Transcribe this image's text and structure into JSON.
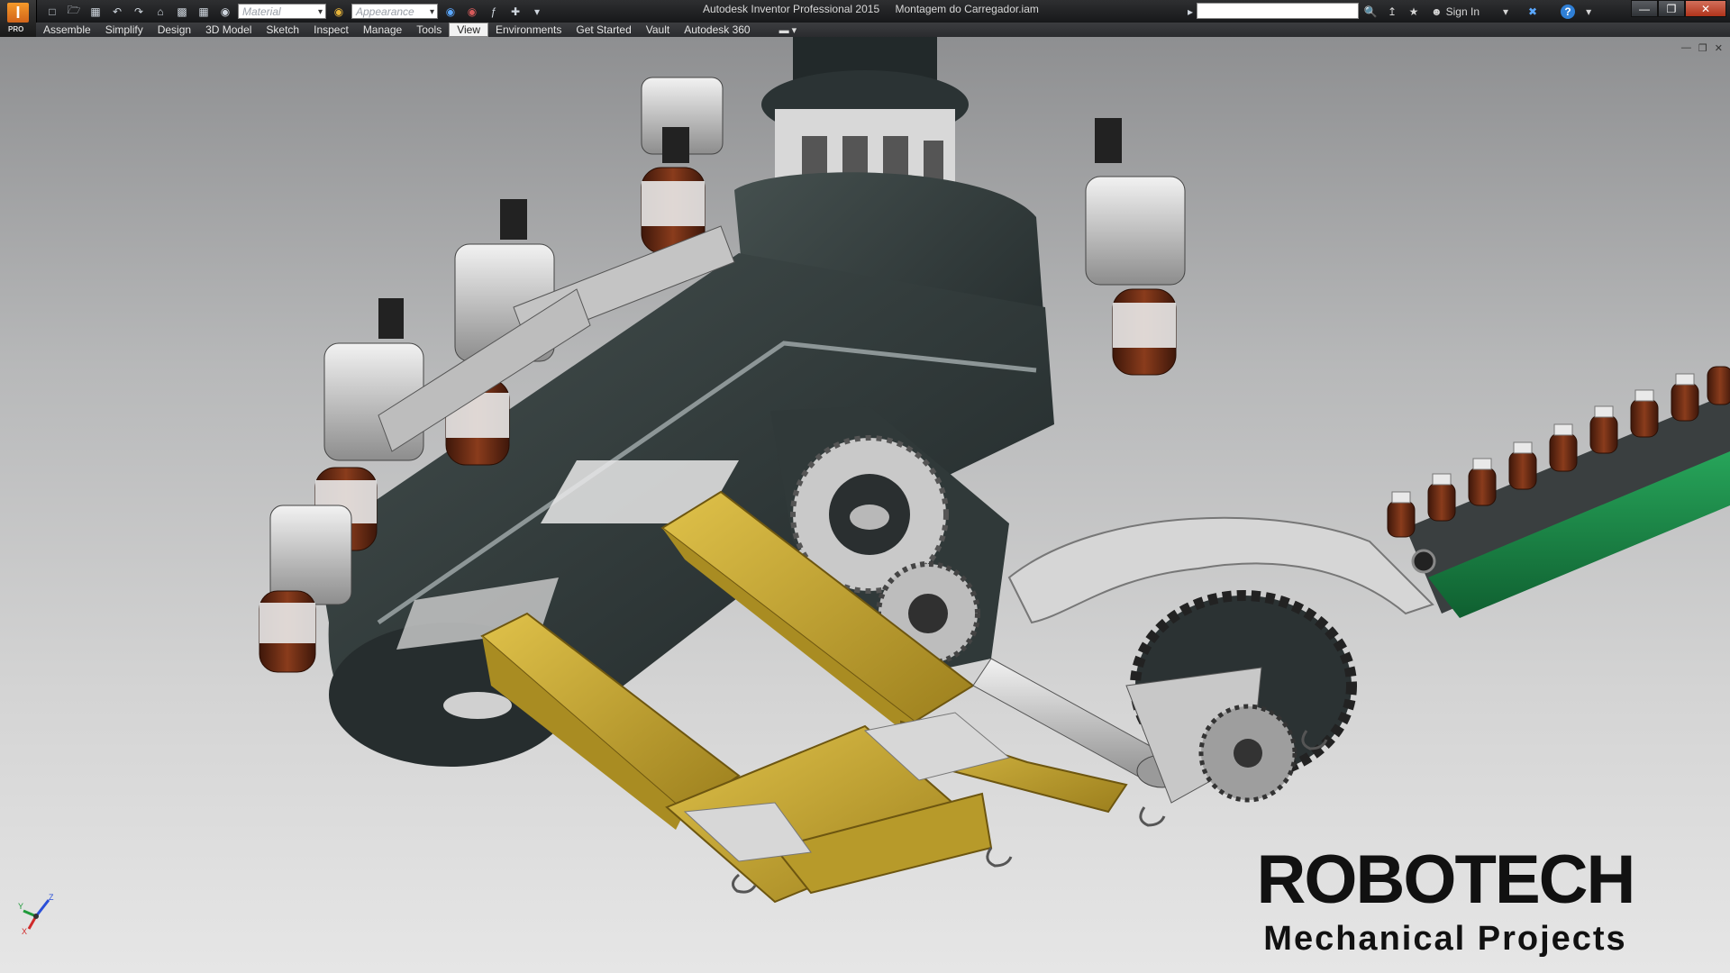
{
  "app": {
    "logo_letter": "I",
    "edition": "PRO",
    "title": "Autodesk Inventor Professional 2015",
    "document": "Montagem do Carregador.iam"
  },
  "quick_access": {
    "material_placeholder": "Material",
    "appearance_placeholder": "Appearance"
  },
  "toolbar_right": {
    "sign_in": "Sign In",
    "help": "?"
  },
  "menu": {
    "items": [
      {
        "label": "Assemble"
      },
      {
        "label": "Simplify"
      },
      {
        "label": "Design"
      },
      {
        "label": "3D Model"
      },
      {
        "label": "Sketch"
      },
      {
        "label": "Inspect"
      },
      {
        "label": "Manage"
      },
      {
        "label": "Tools"
      },
      {
        "label": "View",
        "active": true
      },
      {
        "label": "Environments"
      },
      {
        "label": "Get Started"
      },
      {
        "label": "Vault"
      },
      {
        "label": "Autodesk 360"
      }
    ]
  },
  "viewport": {
    "brand": "ROBOTECH",
    "brand_subtitle": "Mechanical Projects",
    "triad_labels": {
      "x": "X",
      "y": "Y",
      "z": "Z"
    }
  },
  "colors": {
    "yellow_frame": "#c9a928",
    "dark_housing": "#2c3436",
    "conveyor_green": "#1f8a4a",
    "bottle_amber": "#6b2a12"
  }
}
